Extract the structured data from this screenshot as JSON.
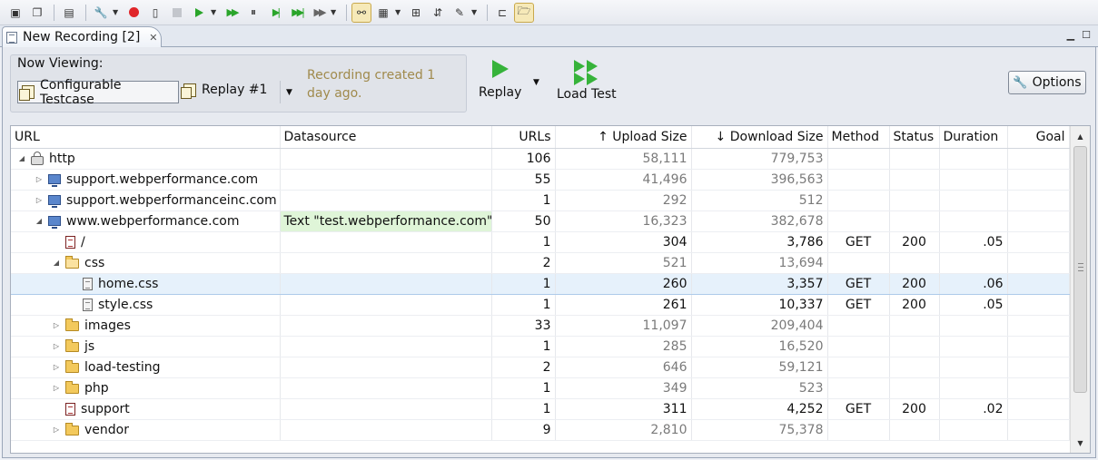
{
  "tab": {
    "title": "New Recording [2]"
  },
  "now_viewing": {
    "label": "Now Viewing:",
    "testcase_label": "Configurable Testcase",
    "replay_label": "Replay #1",
    "created_text": "Recording created 1 day ago."
  },
  "actions": {
    "replay_label": "Replay",
    "load_test_label": "Load Test",
    "options_label": "Options"
  },
  "table": {
    "columns": [
      "URL",
      "Datasource",
      "URLs",
      "Upload Size",
      "Download Size",
      "Method",
      "Status",
      "Duration",
      "Goal"
    ],
    "upload_arrow": "↑",
    "download_arrow": "↓",
    "rows": [
      {
        "url": "http",
        "datasource": "",
        "urls": "106",
        "upload": "58,111",
        "download": "779,753",
        "method": "",
        "status": "",
        "duration": "",
        "goal": ""
      },
      {
        "url": "support.webperformance.com",
        "datasource": "",
        "urls": "55",
        "upload": "41,496",
        "download": "396,563",
        "method": "",
        "status": "",
        "duration": "",
        "goal": ""
      },
      {
        "url": "support.webperformanceinc.com",
        "datasource": "",
        "urls": "1",
        "upload": "292",
        "download": "512",
        "method": "",
        "status": "",
        "duration": "",
        "goal": ""
      },
      {
        "url": "www.webperformance.com",
        "datasource": "Text \"test.webperformance.com\"",
        "urls": "50",
        "upload": "16,323",
        "download": "382,678",
        "method": "",
        "status": "",
        "duration": "",
        "goal": ""
      },
      {
        "url": "/",
        "datasource": "",
        "urls": "1",
        "upload": "304",
        "download": "3,786",
        "method": "GET",
        "status": "200",
        "duration": ".05",
        "goal": ""
      },
      {
        "url": "css",
        "datasource": "",
        "urls": "2",
        "upload": "521",
        "download": "13,694",
        "method": "",
        "status": "",
        "duration": "",
        "goal": ""
      },
      {
        "url": "home.css",
        "datasource": "",
        "urls": "1",
        "upload": "260",
        "download": "3,357",
        "method": "GET",
        "status": "200",
        "duration": ".06",
        "goal": ""
      },
      {
        "url": "style.css",
        "datasource": "",
        "urls": "1",
        "upload": "261",
        "download": "10,337",
        "method": "GET",
        "status": "200",
        "duration": ".05",
        "goal": ""
      },
      {
        "url": "images",
        "datasource": "",
        "urls": "33",
        "upload": "11,097",
        "download": "209,404",
        "method": "",
        "status": "",
        "duration": "",
        "goal": ""
      },
      {
        "url": "js",
        "datasource": "",
        "urls": "1",
        "upload": "285",
        "download": "16,520",
        "method": "",
        "status": "",
        "duration": "",
        "goal": ""
      },
      {
        "url": "load-testing",
        "datasource": "",
        "urls": "2",
        "upload": "646",
        "download": "59,121",
        "method": "",
        "status": "",
        "duration": "",
        "goal": ""
      },
      {
        "url": "php",
        "datasource": "",
        "urls": "1",
        "upload": "349",
        "download": "523",
        "method": "",
        "status": "",
        "duration": "",
        "goal": ""
      },
      {
        "url": "support",
        "datasource": "",
        "urls": "1",
        "upload": "311",
        "download": "4,252",
        "method": "GET",
        "status": "200",
        "duration": ".02",
        "goal": ""
      },
      {
        "url": "vendor",
        "datasource": "",
        "urls": "9",
        "upload": "2,810",
        "download": "75,378",
        "method": "",
        "status": "",
        "duration": "",
        "goal": ""
      }
    ]
  },
  "icons": {
    "toolbar": [
      "record-icon",
      "play-icon",
      "fast-forward-icon",
      "options-icon"
    ],
    "row_icons": [
      "lock-icon",
      "server-icon",
      "server-icon",
      "server-icon",
      "page-icon",
      "folder-open-icon",
      "file-icon",
      "file-icon",
      "folder-icon",
      "folder-icon",
      "folder-icon",
      "folder-icon",
      "page-icon",
      "folder-icon"
    ]
  },
  "colors": {
    "selected_row": "#e6f1fb",
    "datasource_highlight": "#dff5d8",
    "created_text": "#a08a4c",
    "play_green": "#36b33a",
    "record_red": "#e0262a"
  }
}
